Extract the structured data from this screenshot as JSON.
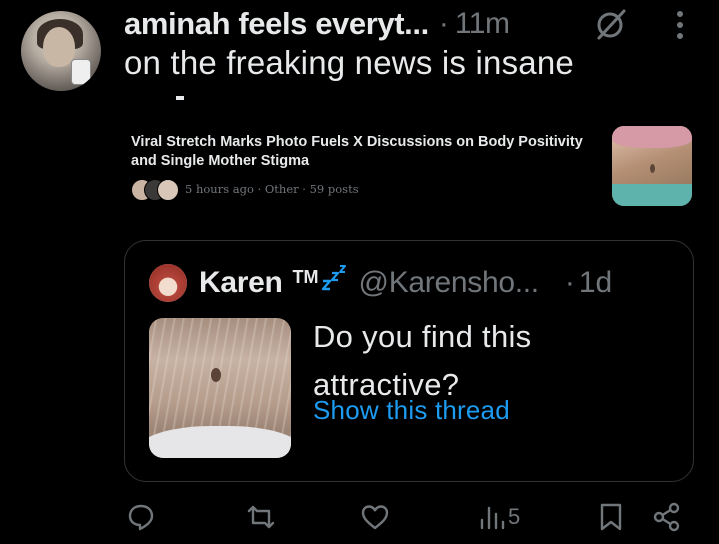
{
  "post": {
    "author_name": "aminah feels everyt...",
    "separator": "·",
    "time": "11m",
    "text": "on the freaking news is insane"
  },
  "news_card": {
    "title": "Viral Stretch Marks Photo Fuels X Discussions on Body Positivity and Single Mother Stigma",
    "meta": "5 hours ago · Other · 59 posts"
  },
  "quoted_post": {
    "author_name": "Karen",
    "tm": "TM",
    "handle": "@Karensho...",
    "separator": "·",
    "time": "1d",
    "text": "Do you find this attractive?",
    "show_thread": "Show this thread"
  },
  "actions": {
    "views": "5",
    "icons": [
      "reply-icon",
      "repost-icon",
      "like-icon",
      "views-icon",
      "bookmark-icon",
      "share-icon"
    ],
    "icon_color": "#71767b"
  },
  "colors": {
    "background": "#000000",
    "text": "#e7e9ea",
    "secondary": "#71767b",
    "link": "#1d9bf0",
    "border": "#2f3336"
  }
}
